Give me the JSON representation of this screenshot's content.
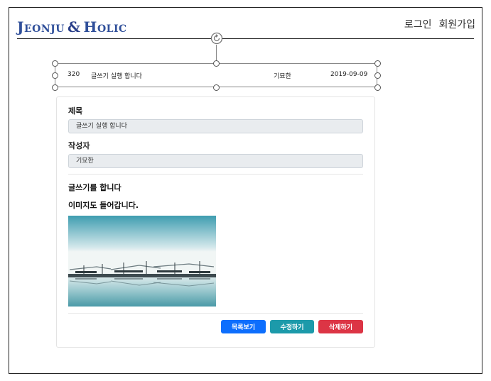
{
  "header": {
    "logo": {
      "first_initial": "J",
      "first_rest": "EONJU",
      "amp": "&",
      "second_initial": "H",
      "second_rest": "OLIC"
    },
    "nav": {
      "login": "로그인",
      "signup": "회원가입"
    }
  },
  "list_row": {
    "number": "320",
    "title": "글쓰기 실행 합니다",
    "author": "기묘한",
    "date": "2019-09-09"
  },
  "post": {
    "title_label": "제목",
    "title_value": "글쓰기 실행 합니다",
    "author_label": "작성자",
    "author_value": "기묘한",
    "content_lines": [
      "글쓰기를 합니다",
      "이미지도 들어갑니다."
    ]
  },
  "buttons": {
    "list": "목록보기",
    "edit": "수정하기",
    "delete": "삭제하기"
  },
  "colors": {
    "logo": "#2f4f9a",
    "btn_list": "#0d6efd",
    "btn_edit": "#1c9aaa",
    "btn_delete": "#dc3545"
  },
  "icons": {
    "rotate_handle": "rotate-icon"
  }
}
